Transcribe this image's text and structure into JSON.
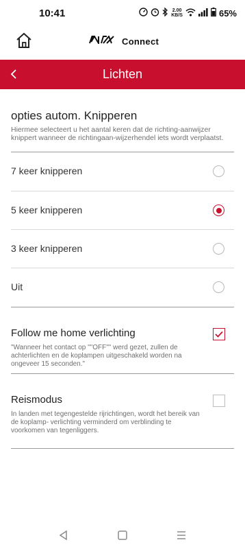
{
  "status_bar": {
    "time": "10:41",
    "network_speed_value": "2.00",
    "network_speed_unit": "KB/S",
    "battery": "65%"
  },
  "header": {
    "brand_logo_text": "KIA",
    "brand_text": "Connect"
  },
  "titlebar": {
    "title": "Lichten"
  },
  "blink_section": {
    "title": "opties autom. Knipperen",
    "description": "Hiermee selecteert u het aantal keren dat de richting-aanwijzer knippert wanneer de richtingaan-wijzerhendel iets wordt verplaatst.",
    "options": [
      {
        "label": "7 keer knipperen",
        "selected": false
      },
      {
        "label": "5 keer knipperen",
        "selected": true
      },
      {
        "label": "3 keer knipperen",
        "selected": false
      },
      {
        "label": "Uit",
        "selected": false
      }
    ]
  },
  "follow_me_home": {
    "title": "Follow me home verlichting",
    "description": "\"Wanneer het contact op \"\"OFF\"\" werd gezet, zullen de achterlichten en de koplampen uitgeschakeld worden na ongeveer 15 seconden.\"",
    "checked": true
  },
  "travel_mode": {
    "title": "Reismodus",
    "description": "In landen met tegengestelde rijrichtingen, wordt het bereik van de koplamp- verlichting verminderd om verblinding te voorkomen van tegenliggers.",
    "checked": false
  },
  "colors": {
    "accent": "#c8102e",
    "text": "#222222",
    "muted": "#6f6f6f"
  },
  "icons": {
    "home": "home-icon",
    "back": "chevron-left-icon",
    "nav_back": "triangle-back-icon",
    "nav_home": "square-home-icon",
    "nav_menu": "menu-icon"
  }
}
